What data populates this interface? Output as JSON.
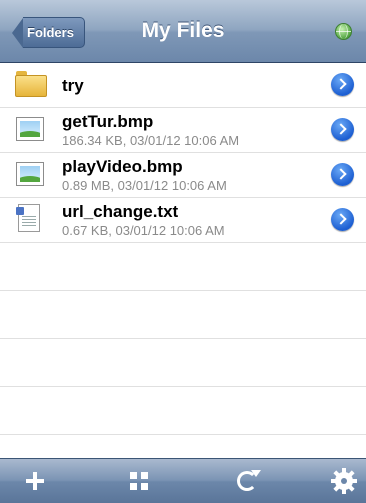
{
  "navbar": {
    "back_label": "Folders",
    "title": "My Files",
    "right_icon": "globe-icon"
  },
  "files": [
    {
      "name": "try",
      "meta": "",
      "type": "folder"
    },
    {
      "name": "getTur.bmp",
      "meta": "186.34 KB, 03/01/12 10:06 AM",
      "type": "image"
    },
    {
      "name": "playVideo.bmp",
      "meta": "0.89 MB, 03/01/12 10:06 AM",
      "type": "image"
    },
    {
      "name": "url_change.txt",
      "meta": "0.67 KB, 03/01/12 10:06 AM",
      "type": "text"
    }
  ],
  "toolbar": {
    "icons": [
      "add-icon",
      "grid-icon",
      "refresh-icon",
      "settings-icon"
    ]
  },
  "colors": {
    "bar_blue": "#6c87aa",
    "disclosure_blue": "#1d5fd2",
    "meta_gray": "#8a8a8a"
  }
}
